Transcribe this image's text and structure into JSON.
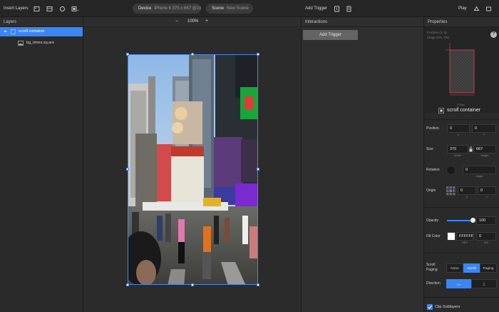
{
  "toolbar": {
    "insert_layers": "Insert Layers",
    "device_key": "Device",
    "device_value": "iPhone 6  375 x 667  @2x",
    "scene_key": "Scene",
    "scene_value": "New Scene",
    "add_trigger": "Add Trigger",
    "play": "Play"
  },
  "layers": {
    "header": "Layers",
    "items": [
      {
        "label": "scroll container"
      },
      {
        "label": "bg_times.sq.are"
      }
    ]
  },
  "canvas": {
    "zoom": "100%",
    "zoom_out": "−",
    "zoom_in": "+"
  },
  "interactions": {
    "header": "Interactions",
    "add_trigger_button": "Add Trigger"
  },
  "properties": {
    "header": "Properties",
    "help": "?",
    "preview_position": "Position   (2, 0)",
    "preview_stage": "Stage     (0%, 0%)",
    "preview_width": "375px",
    "layer_name": "scroll container",
    "position": {
      "label": "Position",
      "x": "0",
      "y": "0",
      "x_sub": "X",
      "y_sub": "Y"
    },
    "size": {
      "label": "Size",
      "w": "375",
      "h": "667",
      "w_sub": "Width",
      "h_sub": "Height"
    },
    "rotation": {
      "label": "Rotation",
      "value": "0",
      "sub": "Angle"
    },
    "origin": {
      "label": "Origin",
      "x": "0",
      "y": "0",
      "x_sub": "X",
      "y_sub": "Y"
    },
    "opacity": {
      "label": "Opacity",
      "value": "100",
      "fraction": 1.0
    },
    "fill": {
      "label": "Fill Color",
      "hex": "FFFFFF",
      "alpha": "0",
      "hex_sub": "HEX",
      "alpha_sub": "A%"
    },
    "scroll": {
      "label_line1": "Scroll",
      "label_line2": "Paging",
      "options": [
        "None",
        "Scroll",
        "Paging"
      ],
      "selected": "Scroll"
    },
    "direction": {
      "label": "Direction",
      "horizontal": "↔",
      "vertical": "↕"
    },
    "clip": {
      "label": "Clip Sublayers",
      "checked": true
    }
  },
  "colors": {
    "accent": "#3b86f7",
    "panel": "#2a2a2a",
    "canvas": "#2b2b2b"
  }
}
